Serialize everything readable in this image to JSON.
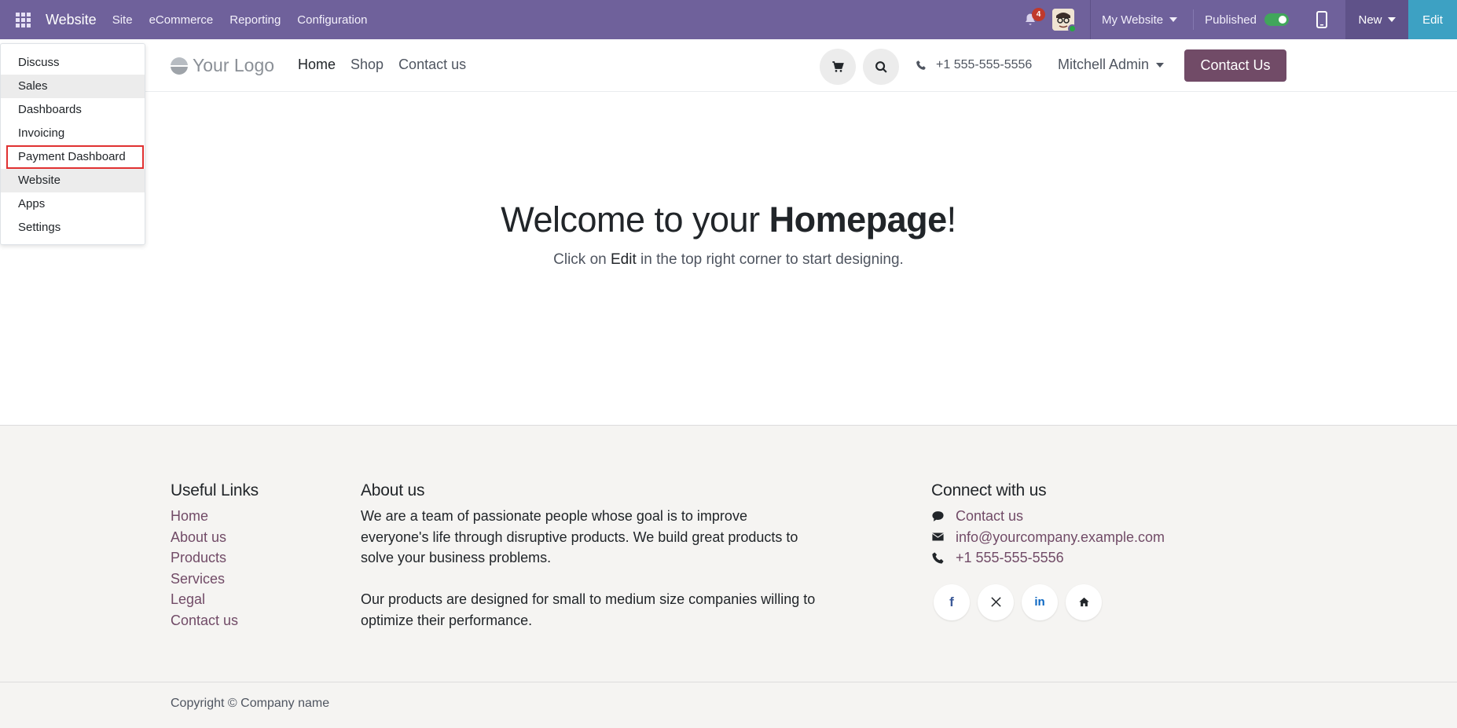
{
  "topbar": {
    "app_name": "Website",
    "menus": [
      "Site",
      "eCommerce",
      "Reporting",
      "Configuration"
    ],
    "notification_count": "4",
    "website_selector": "My Website",
    "published_label": "Published",
    "new_label": "New",
    "edit_label": "Edit",
    "color": "#6f619b"
  },
  "app_menu": {
    "items": [
      "Discuss",
      "Sales",
      "Dashboards",
      "Invoicing",
      "Payment Dashboard",
      "Website",
      "Apps",
      "Settings"
    ]
  },
  "site_header": {
    "logo_text": "Your Logo",
    "nav": [
      "Home",
      "Shop",
      "Contact us"
    ],
    "phone": "+1 555-555-5556",
    "user": "Mitchell Admin",
    "cta": "Contact Us",
    "cta_color": "#714b67"
  },
  "hero": {
    "title_pre": "Welcome to your ",
    "title_bold": "Homepage",
    "title_post": "!",
    "sub_pre": "Click on ",
    "sub_em": "Edit",
    "sub_post": " in the top right corner to start designing."
  },
  "footer": {
    "useful_title": "Useful Links",
    "useful_links": [
      "Home",
      "About us",
      "Products",
      "Services",
      "Legal",
      "Contact us"
    ],
    "about_title": "About us",
    "about_p1": "We are a team of passionate people whose goal is to improve everyone's life through disruptive products. We build great products to solve your business problems.",
    "about_p2": "Our products are designed for small to medium size companies willing to optimize their performance.",
    "connect_title": "Connect with us",
    "connect_contact": "Contact us",
    "connect_email": "info@yourcompany.example.com",
    "connect_phone": "+1 555-555-5556",
    "social_icons": [
      "facebook-icon",
      "x-icon",
      "linkedin-icon",
      "home-icon"
    ],
    "copyright": "Copyright © Company name"
  }
}
